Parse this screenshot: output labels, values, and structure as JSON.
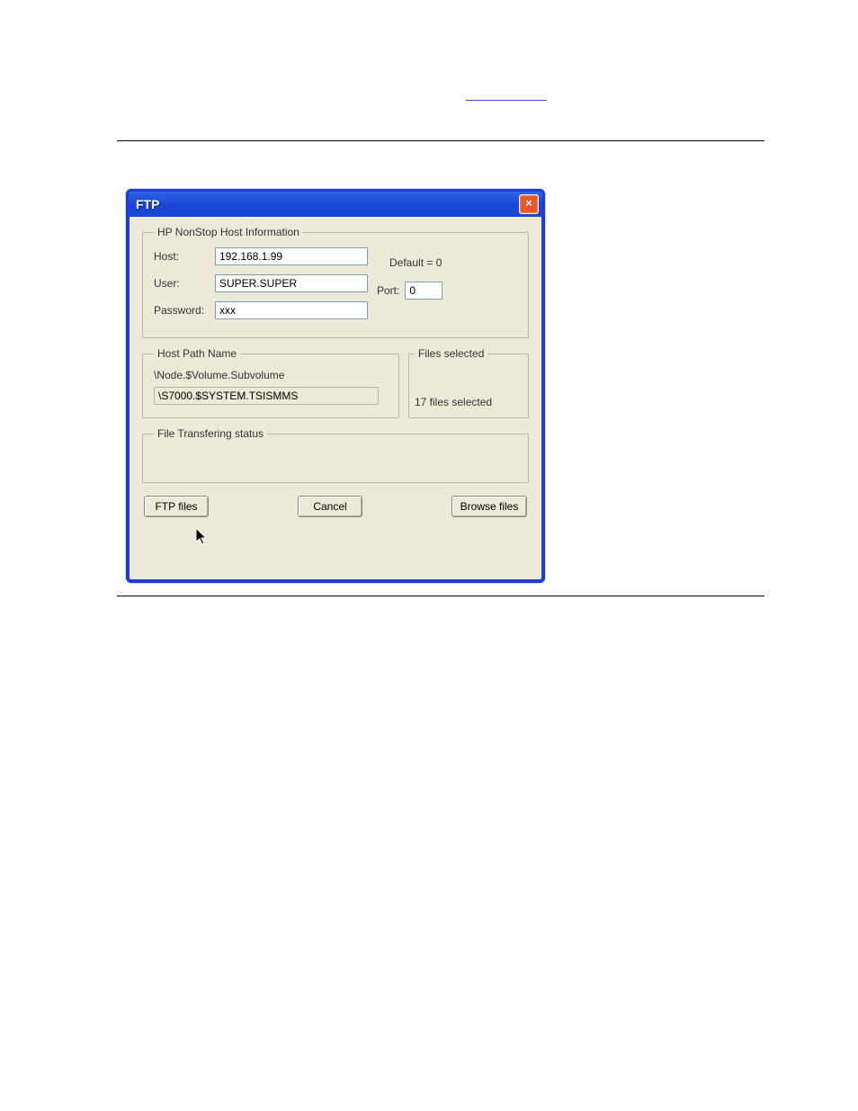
{
  "dialog": {
    "title": "FTP",
    "close_label": "×"
  },
  "host_info": {
    "legend": "HP NonStop Host Information",
    "host_label": "Host:",
    "host_value": "192.168.1.99",
    "user_label": "User:",
    "user_value": "SUPER.SUPER",
    "password_label": "Password:",
    "password_value": "xxx",
    "default_label": "Default = 0",
    "port_label": "Port:",
    "port_value": "0"
  },
  "host_path": {
    "legend": "Host Path Name",
    "hint": "\\Node.$Volume.Subvolume",
    "value": "\\S7000.$SYSTEM.TSISMMS"
  },
  "files_selected": {
    "legend": "Files selected",
    "count": "17 files selected"
  },
  "status": {
    "legend": "File Transfering status"
  },
  "buttons": {
    "ftp": "FTP files",
    "cancel": "Cancel",
    "browse": "Browse files"
  }
}
